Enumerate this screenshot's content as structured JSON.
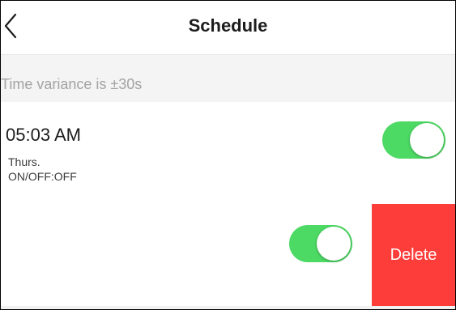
{
  "nav": {
    "title": "Schedule",
    "back_icon": "chevron-left-icon"
  },
  "notice": {
    "text": "Time variance is  ±30s"
  },
  "schedules": [
    {
      "time": "05:03 AM",
      "days": "Thurs.",
      "state": "ON/OFF:OFF",
      "enabled": true
    },
    {
      "enabled": true,
      "delete_label": "Delete"
    }
  ],
  "colors": {
    "toggle_on": "#4cd964",
    "delete_bg": "#fc3d39",
    "notice_text": "#a3a3a3",
    "notice_bg": "#f4f4f4"
  }
}
